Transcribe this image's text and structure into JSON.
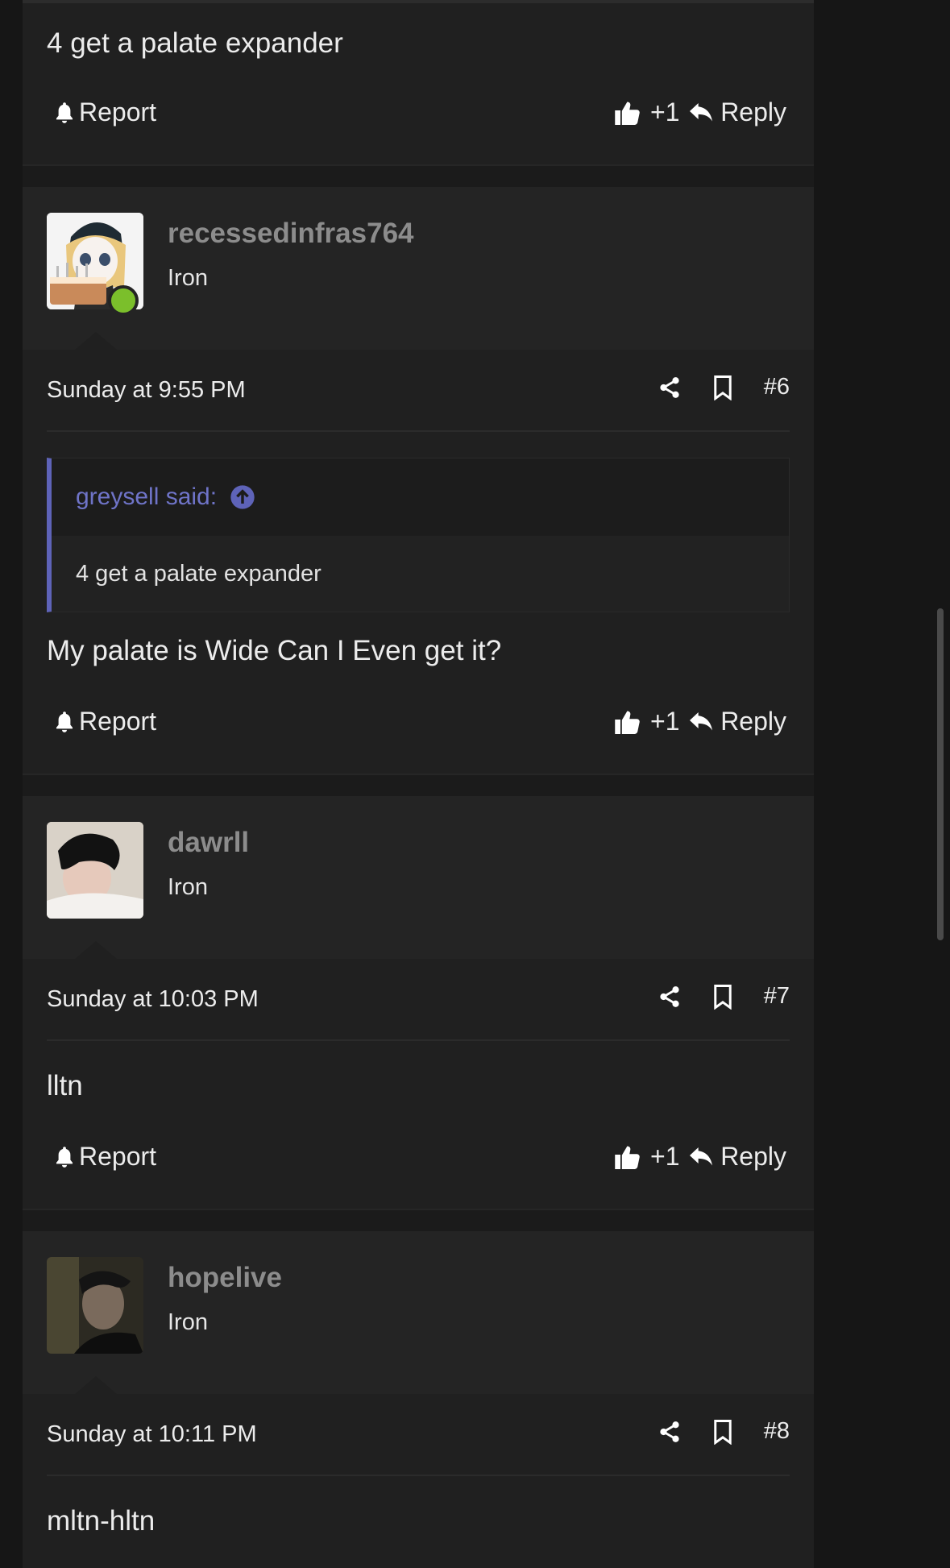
{
  "labels": {
    "report": "Report",
    "like": "+1",
    "reply": "Reply"
  },
  "top_post": {
    "message": "4 get a palate expander"
  },
  "posts": [
    {
      "username": "recessedinfras764",
      "rank": "Iron",
      "time": "Sunday at 9:55 PM",
      "number": "#6",
      "quote": {
        "author": "greysell said:",
        "text": "4 get a palate expander"
      },
      "message": "My palate is Wide Can I Even get it?"
    },
    {
      "username": "dawrll",
      "rank": "Iron",
      "time": "Sunday at 10:03 PM",
      "number": "#7",
      "message": "lltn"
    },
    {
      "username": "hopelive",
      "rank": "Iron",
      "time": "Sunday at 10:11 PM",
      "number": "#8",
      "message": "mltn-hltn"
    }
  ],
  "colors": {
    "accent": "#5e63b8",
    "online": "#7bbf2b",
    "username": "#8c8c8c"
  }
}
